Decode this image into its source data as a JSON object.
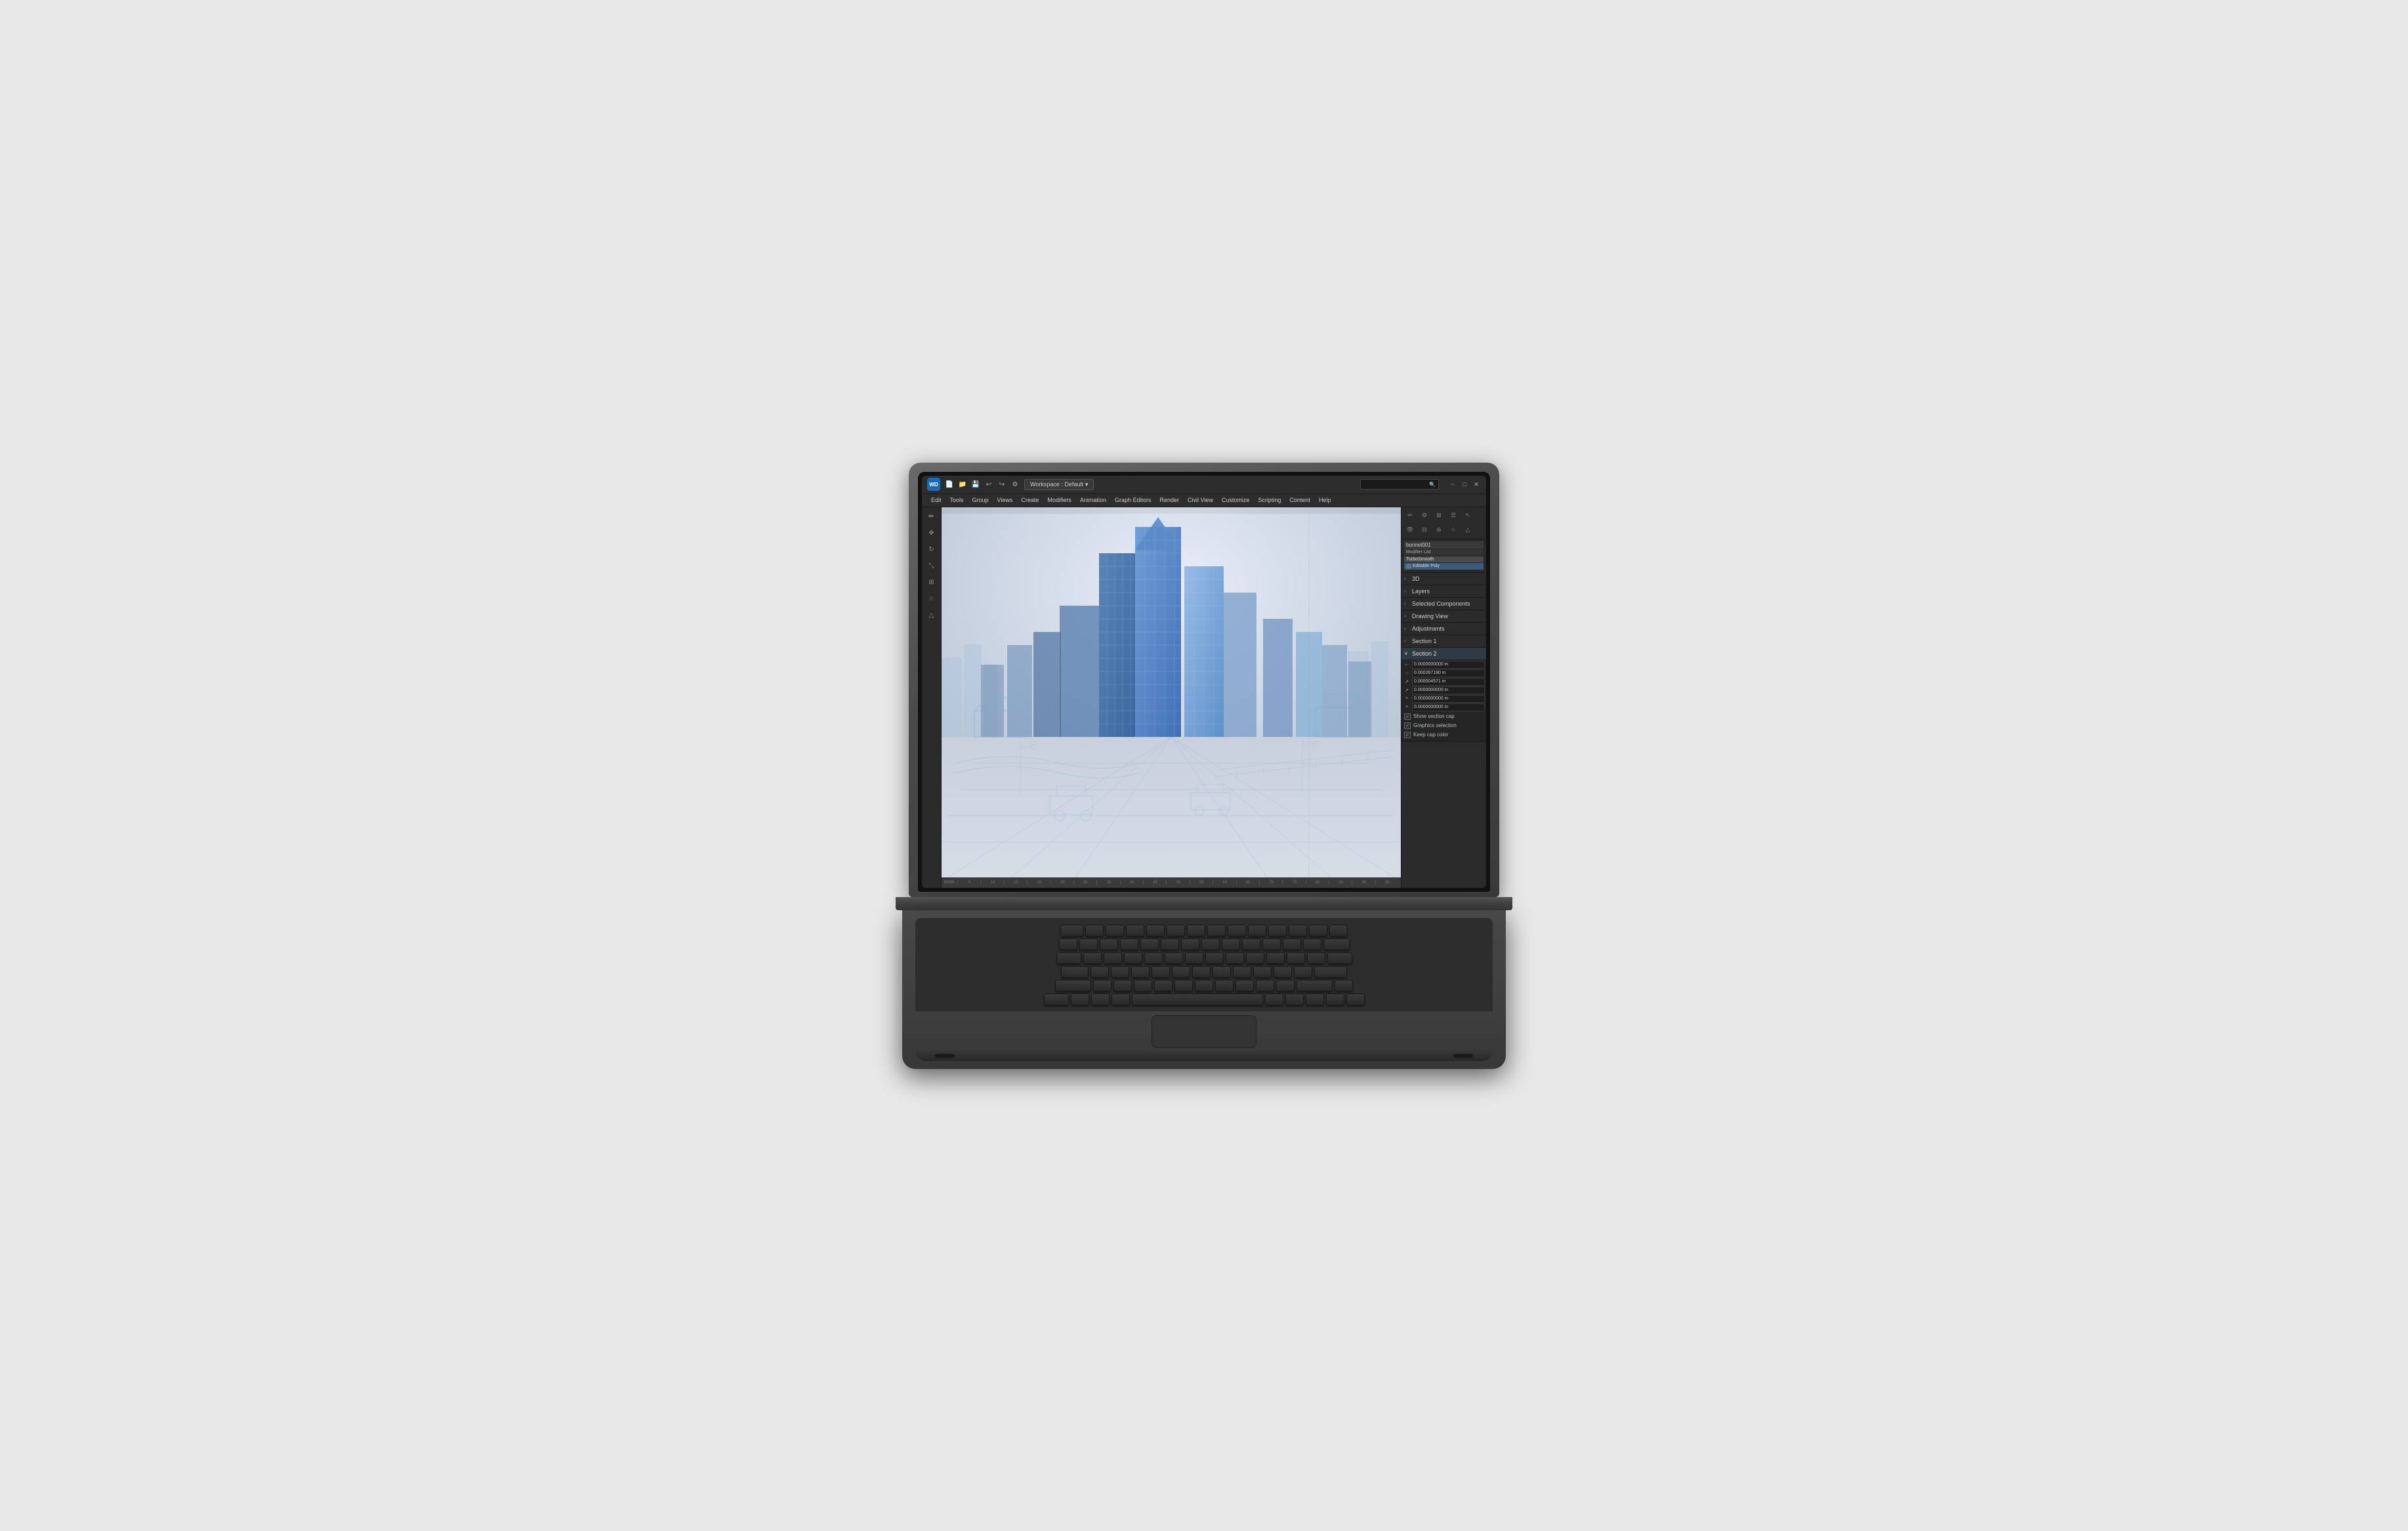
{
  "app": {
    "icon_text": "WD",
    "workspace_label": "Workspace : Default",
    "search_placeholder": ""
  },
  "titlebar": {
    "icons": [
      "file",
      "folder",
      "save",
      "undo",
      "redo",
      "settings"
    ],
    "window_controls": [
      "−",
      "□",
      "✕"
    ]
  },
  "menubar": {
    "items": [
      "Edit",
      "Tools",
      "Group",
      "Views",
      "Create",
      "Modifiers",
      "Animation",
      "Graph Editors",
      "Render",
      "Civil View",
      "Customize",
      "Scripting",
      "Content",
      "Help"
    ]
  },
  "right_panel": {
    "object_name": "bonnet001",
    "modifier_list_label": "Modifier List",
    "modifiers": [
      {
        "name": "TurboSmooth",
        "active": false
      },
      {
        "name": "Editable Poly",
        "active": true,
        "checked": true
      }
    ],
    "sections": [
      {
        "id": "3d",
        "label": "3D",
        "expanded": false
      },
      {
        "id": "layers",
        "label": "Layers",
        "expanded": false
      },
      {
        "id": "selected_components",
        "label": "Selected Components",
        "expanded": false
      },
      {
        "id": "drawing_view",
        "label": "Drawing View",
        "expanded": false
      },
      {
        "id": "adjustments",
        "label": "Adjustments",
        "expanded": false
      },
      {
        "id": "section1",
        "label": "Section 1",
        "expanded": false
      },
      {
        "id": "section2",
        "label": "Section 2",
        "expanded": true
      }
    ],
    "section2": {
      "params": [
        {
          "icon": "⊢",
          "value": "0.0000000000 in"
        },
        {
          "icon": "↔",
          "value": "0.000267190 in"
        },
        {
          "icon": "↗",
          "value": "0.000004571 in"
        },
        {
          "icon": "↗",
          "value": "0.0000000000 in"
        },
        {
          "icon": "≡",
          "value": "0.0000000000 in"
        },
        {
          "icon": "≡",
          "value": "0.0000000000 in"
        }
      ],
      "checkboxes": [
        {
          "label": "Show section cap",
          "checked": true
        },
        {
          "label": "Graphics selection",
          "checked": true
        },
        {
          "label": "Keep cap color",
          "checked": true
        }
      ]
    }
  },
  "ruler": {
    "start": "0/100",
    "ticks": [
      "5",
      "10",
      "15",
      "20",
      "25",
      "30",
      "35",
      "40",
      "45",
      "50",
      "55",
      "60",
      "65",
      "70",
      "75",
      "80",
      "85",
      "90",
      "95"
    ]
  }
}
